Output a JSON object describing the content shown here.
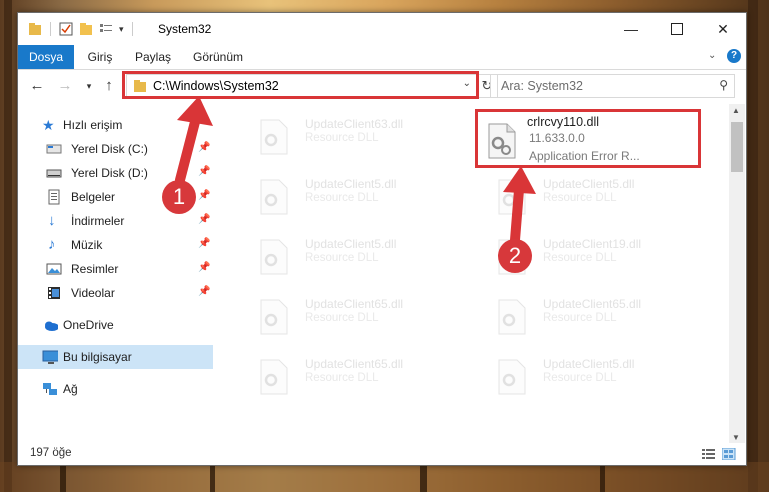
{
  "window": {
    "title": "System32"
  },
  "ribbon": {
    "tabs": [
      "Dosya",
      "Giriş",
      "Paylaş",
      "Görünüm"
    ]
  },
  "address": {
    "path": "C:\\Windows\\System32"
  },
  "search": {
    "placeholder": "Ara: System32"
  },
  "nav": {
    "items": [
      {
        "label": "Hızlı erişim",
        "icon": "star-icon"
      },
      {
        "label": "Yerel Disk (C:)",
        "icon": "drive-icon",
        "pinned": true
      },
      {
        "label": "Yerel Disk (D:)",
        "icon": "drive-icon",
        "pinned": true
      },
      {
        "label": "Belgeler",
        "icon": "documents-icon",
        "pinned": true
      },
      {
        "label": "İndirmeler",
        "icon": "download-icon",
        "pinned": true
      },
      {
        "label": "Müzik",
        "icon": "music-icon",
        "pinned": true
      },
      {
        "label": "Resimler",
        "icon": "pictures-icon",
        "pinned": true
      },
      {
        "label": "Videolar",
        "icon": "video-icon",
        "pinned": true
      },
      {
        "label": "OneDrive",
        "icon": "cloud-icon"
      },
      {
        "label": "Bu bilgisayar",
        "icon": "computer-icon",
        "selected": true
      },
      {
        "label": "Ağ",
        "icon": "network-icon"
      }
    ]
  },
  "files": {
    "highlighted": {
      "name": "crlrcvy110.dll",
      "version": "11.633.0.0",
      "description": "Application Error R..."
    },
    "background": [
      {
        "name": "UpdateClient63.dll",
        "description": "Resource DLL"
      },
      {
        "name": "UpdateClient5.dll",
        "description": "Resource DLL"
      },
      {
        "name": "UpdateClient5.dll",
        "description": "Resource DLL"
      },
      {
        "name": "UpdateClient65.dll",
        "description": "Resource DLL"
      },
      {
        "name": "UpdateClient65.dll",
        "description": "Resource DLL"
      },
      {
        "name": "UpdateClient5.dll",
        "description": "Resource DLL"
      },
      {
        "name": "UpdateClient19.dll",
        "description": "Resource DLL"
      },
      {
        "name": "UpdateClient65.dll",
        "description": "Resource DLL"
      },
      {
        "name": "UpdateClient5.dll",
        "description": "Resource DLL"
      }
    ]
  },
  "status": {
    "count": "197 öğe"
  },
  "annotations": {
    "step1": "1",
    "step2": "2",
    "color": "#d93537"
  }
}
